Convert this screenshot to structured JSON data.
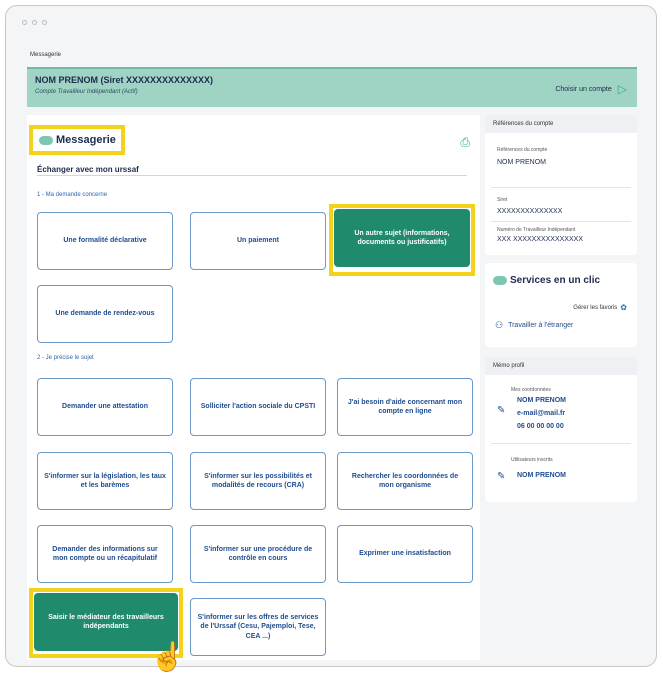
{
  "breadcrumb": "Messagerie",
  "account": {
    "name": "NOM PRENOM (Siret XXXXXXXXXXXXXX)",
    "type": "Compte Travailleur Indépendant (Actif)",
    "switch_label": "Choisir un compte"
  },
  "messagerie": {
    "title": "Messagerie",
    "exchange_label": "Échanger avec mon urssaf",
    "section1": "1 - Ma demande concerne",
    "section2": "2 - Je précise le sujet",
    "tiles1": [
      {
        "label": "Une formalité déclarative"
      },
      {
        "label": "Un paiement"
      },
      {
        "label": "Un autre sujet (informations, documents ou justificatifs)"
      },
      {
        "label": "Une demande de rendez-vous"
      }
    ],
    "tiles2": [
      {
        "label": "Demander une attestation"
      },
      {
        "label": "Solliciter l'action sociale du CPSTI"
      },
      {
        "label": "J'ai besoin d'aide concernant mon compte en ligne"
      },
      {
        "label": "S'informer sur la législation, les taux et les barèmes"
      },
      {
        "label": "S'informer sur les possibilités et modalités de recours (CRA)"
      },
      {
        "label": "Rechercher les coordonnées de mon organisme"
      },
      {
        "label": "Demander des informations sur mon compte ou un récapitulatif"
      },
      {
        "label": "S'informer sur une procédure de contrôle en cours"
      },
      {
        "label": "Exprimer une insatisfaction"
      },
      {
        "label": "Saisir le médiateur des travailleurs indépendants"
      },
      {
        "label": "S'informer sur les offres de services de l'Urssaf (Cesu, Pajemploi, Tese, CEA ...)"
      }
    ]
  },
  "refs": {
    "header": "Références du compte",
    "refs_label": "Références du compte",
    "name": "NOM PRENOM",
    "siret_label": "Siret",
    "siret": "XXXXXXXXXXXXXX",
    "ti_label": "Numéro de Travailleur Indépendant",
    "ti_number": "XXX XXXXXXXXXXXXXXX"
  },
  "services": {
    "title": "Services en un clic",
    "favorites": "Gérer les favoris",
    "item": "Travailler à l'étranger"
  },
  "profile": {
    "header": "Mémo profil",
    "coords_label": "Mes coordonnées",
    "name": "NOM PRENOM",
    "email": "e-mail@mail.fr",
    "phone": "06 00 00 00 00",
    "users_label": "Utilisateurs inscrits",
    "user": "NOM PRENOM"
  }
}
